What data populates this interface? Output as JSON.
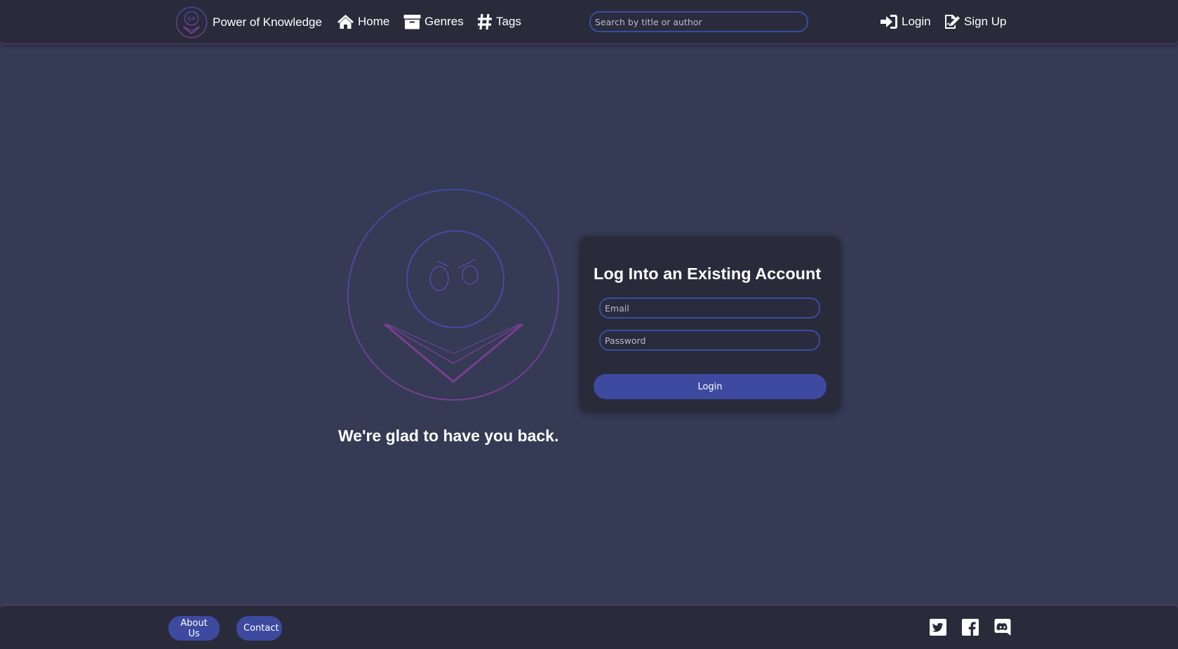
{
  "header": {
    "brand": "Power of Knowledge",
    "brand_icon": "book-reader-logo-icon",
    "nav": {
      "home": "Home",
      "genres": "Genres",
      "tags": "Tags"
    },
    "search": {
      "placeholder": "Search by title or author",
      "value": ""
    },
    "auth": {
      "login": "Login",
      "signup": "Sign Up"
    }
  },
  "hero": {
    "tagline": "We're glad to have you back."
  },
  "login_card": {
    "title": "Log Into an Existing Account",
    "email_placeholder": "Email",
    "password_placeholder": "Password",
    "submit_label": "Login"
  },
  "footer": {
    "about": "About Us",
    "contact": "Contact",
    "social": [
      "twitter-icon",
      "facebook-icon",
      "discord-icon"
    ]
  },
  "colors": {
    "background": "#353a55",
    "bar": "#292b3b",
    "accent": "#3d4aa0",
    "logo_gradient_start": "#3d4aa0",
    "logo_gradient_end": "#7a3e90"
  }
}
